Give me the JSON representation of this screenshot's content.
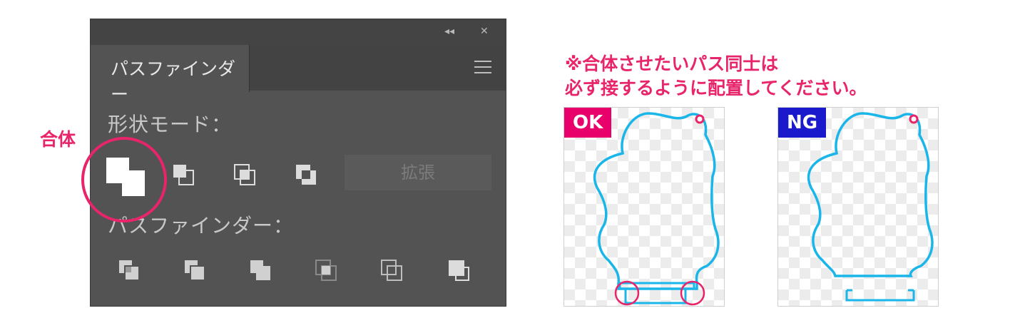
{
  "panel": {
    "title": "パスファインダー",
    "titlebar_collapse": "◂◂",
    "titlebar_close": "✕",
    "shape_modes_label": "形状モード：",
    "pathfinders_label": "パスファインダー：",
    "expand_label": "拡張",
    "shape_mode_icons": [
      "unite-icon",
      "minus-front-icon",
      "intersect-icon",
      "exclude-icon"
    ],
    "pathfinder_icons": [
      "divide-icon",
      "trim-icon",
      "merge-icon",
      "crop-icon",
      "outline-icon",
      "minus-back-icon"
    ]
  },
  "annotation": {
    "unite_label": "合体",
    "note_line1": "※合体させたいパス同士は",
    "note_line2": "必ず接するように配置してください。"
  },
  "examples": [
    {
      "badge": "OK",
      "badge_color": "#e8006b",
      "connected": true
    },
    {
      "badge": "NG",
      "badge_color": "#1a1acc",
      "connected": false
    }
  ],
  "colors": {
    "accent": "#e8246b",
    "outline": "#1ab6ea",
    "panel_bg": "#535353"
  }
}
